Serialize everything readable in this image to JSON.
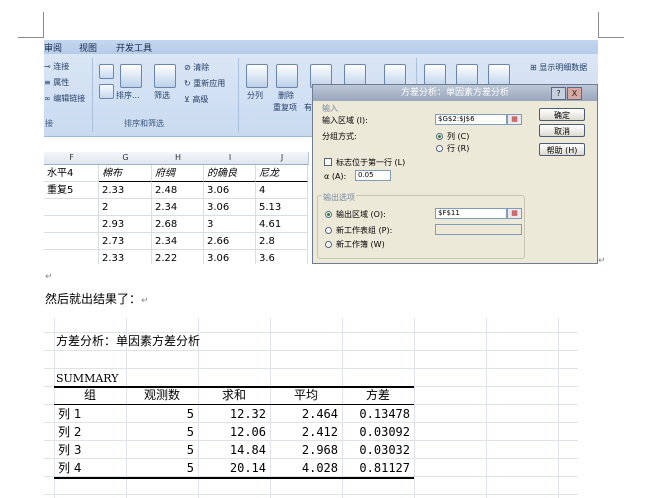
{
  "ribbon": {
    "tabs": [
      "审阅",
      "视图",
      "开发工具"
    ],
    "left_items": [
      "连接",
      "属性",
      "编辑链接"
    ],
    "left_group": "接",
    "sort_label": "排序...",
    "filter_label": "筛选",
    "clear_label": "清除",
    "reapply_label": "重新应用",
    "advanced_label": "高级",
    "sort_filter_group": "排序和筛选",
    "split_label": "分列",
    "remove_dup_label": "删除",
    "remove_dup_label2": "重复项",
    "trailing_label": "有",
    "show_detail_label": "显示明细数据"
  },
  "sheet1": {
    "columns": [
      "F",
      "G",
      "H",
      "I",
      "J"
    ],
    "rows": [
      [
        "水平4",
        "棉布",
        "府绸",
        "的确良",
        "尼龙"
      ],
      [
        "重复5",
        "2.33",
        "2.48",
        "3.06",
        "4"
      ],
      [
        "",
        "2",
        "2.34",
        "3.06",
        "5.13"
      ],
      [
        "",
        "2.93",
        "2.68",
        "3",
        "4.61"
      ],
      [
        "",
        "2.73",
        "2.34",
        "2.66",
        "2.8"
      ],
      [
        "",
        "2.33",
        "2.22",
        "3.06",
        "3.6"
      ]
    ]
  },
  "dialog": {
    "title": "方差分析：单因素方差分析",
    "help_btn": "?",
    "close_btn": "X",
    "input_section": "输入",
    "input_range_label": "输入区域 (I):",
    "input_range_value": "$G$2:$J$6",
    "grouped_by_label": "分组方式:",
    "opt_columns": "列 (C)",
    "opt_rows": "行 (R)",
    "labels_first_row": "标志位于第一行 (L)",
    "alpha_label": "α (A):",
    "alpha_value": "0.05",
    "output_section": "输出选项",
    "output_range_label": "输出区域 (O):",
    "output_range_value": "$F$11",
    "new_sheet_label": "新工作表组 (P):",
    "new_workbook_label": "新工作簿 (W)",
    "ok_btn": "确定",
    "cancel_btn": "取消",
    "help_btn_label": "帮助 (H)",
    "pick_icon": "range-picker-icon"
  },
  "doc": {
    "para_mark": "↵",
    "sentence": "然后就出结果了：",
    "sentence_mark": "↵"
  },
  "results": {
    "title": "方差分析：单因素方差分析",
    "summary": "SUMMARY",
    "headers": [
      "组",
      "观测数",
      "求和",
      "平均",
      "方差"
    ],
    "rows": [
      [
        "列 1",
        "5",
        "12.32",
        "2.464",
        "0.13478"
      ],
      [
        "列 2",
        "5",
        "12.06",
        "2.412",
        "0.03092"
      ],
      [
        "列 3",
        "5",
        "14.84",
        "2.968",
        "0.03032"
      ],
      [
        "列 4",
        "5",
        "20.14",
        "4.028",
        "0.81127"
      ]
    ]
  }
}
